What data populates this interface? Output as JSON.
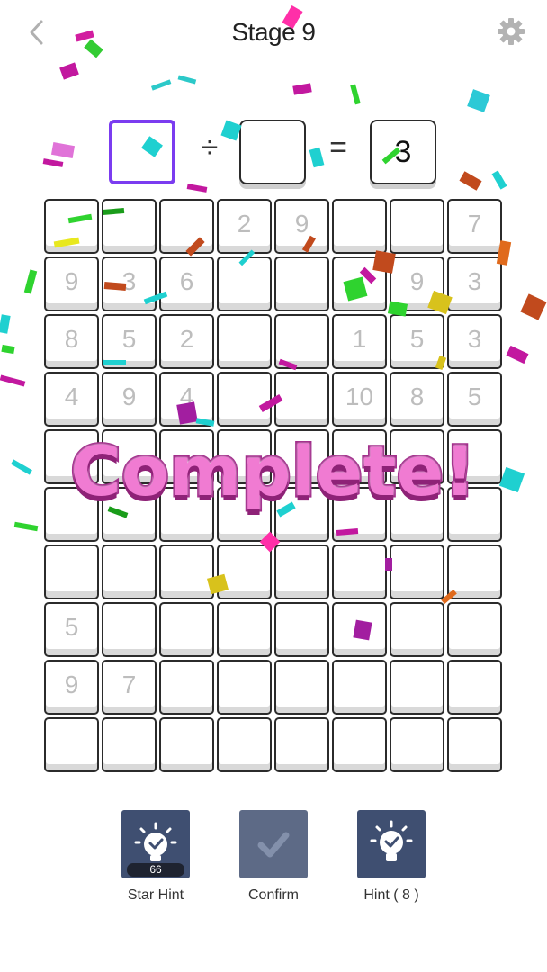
{
  "header": {
    "title": "Stage 9",
    "back_icon": "chevron-left-icon",
    "settings_icon": "gear-icon"
  },
  "equation": {
    "operand1": "",
    "operator": "÷",
    "operand2": "",
    "equals": "=",
    "result": "3",
    "active_color": "#7b3cf0"
  },
  "grid": {
    "rows": [
      [
        "",
        "",
        "",
        "2",
        "9",
        "",
        "",
        "7"
      ],
      [
        "9",
        "3",
        "6",
        "",
        "",
        "",
        "9",
        "3"
      ],
      [
        "8",
        "5",
        "2",
        "",
        "",
        "1",
        "5",
        "3"
      ],
      [
        "4",
        "9",
        "4",
        "",
        "",
        "10",
        "8",
        "5"
      ],
      [
        "",
        "",
        "",
        "",
        "",
        "",
        "",
        ""
      ],
      [
        "",
        "",
        "",
        "",
        "",
        "",
        "",
        ""
      ],
      [
        "",
        "",
        "",
        "",
        "",
        "",
        "",
        ""
      ],
      [
        "5",
        "",
        "",
        "",
        "",
        "",
        "",
        ""
      ],
      [
        "9",
        "7",
        "",
        "",
        "",
        "",
        "",
        ""
      ],
      [
        "",
        "",
        "",
        "",
        "",
        "",
        "",
        ""
      ]
    ]
  },
  "banner": {
    "text": "Complete!"
  },
  "tools": {
    "star_hint": {
      "label": "Star Hint",
      "count": "66",
      "icon": "lightbulb-check-icon"
    },
    "confirm": {
      "label": "Confirm",
      "icon": "check-icon"
    },
    "hint": {
      "label": "Hint ( 8 )",
      "icon": "lightbulb-check-icon"
    }
  },
  "colors": {
    "tool_bg": "#3f4f71",
    "banner_fill": "#f07bd2",
    "banner_stroke": "#a12c8a"
  }
}
